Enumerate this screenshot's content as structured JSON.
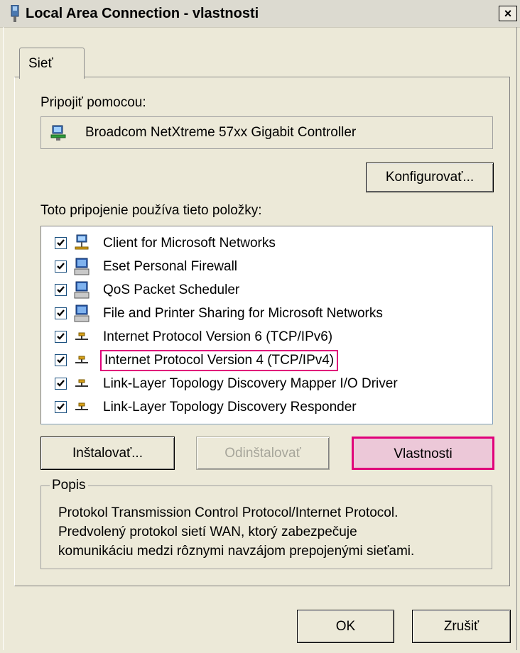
{
  "window": {
    "title": "Local Area Connection - vlastnosti",
    "close_label": "×"
  },
  "tabs": [
    {
      "label": "Sieť",
      "active": true
    }
  ],
  "connect_using": {
    "label": "Pripojiť pomocou:",
    "adapter_name": "Broadcom NetXtreme 57xx Gigabit Controller",
    "configure_label": "Konfigurovať..."
  },
  "components": {
    "label": "Toto pripojenie používa tieto položky:",
    "items": [
      {
        "label": "Client for Microsoft Networks",
        "checked": true,
        "icon": "network-client-icon"
      },
      {
        "label": "Eset Personal Firewall",
        "checked": true,
        "icon": "computer-service-icon"
      },
      {
        "label": "QoS Packet Scheduler",
        "checked": true,
        "icon": "computer-service-icon"
      },
      {
        "label": "File and Printer Sharing for Microsoft Networks",
        "checked": true,
        "icon": "computer-service-icon"
      },
      {
        "label": "Internet Protocol Version 6 (TCP/IPv6)",
        "checked": true,
        "icon": "protocol-icon"
      },
      {
        "label": "Internet Protocol Version 4 (TCP/IPv4)",
        "checked": true,
        "icon": "protocol-icon",
        "highlighted": true
      },
      {
        "label": "Link-Layer Topology Discovery Mapper I/O Driver",
        "checked": true,
        "icon": "protocol-icon"
      },
      {
        "label": "Link-Layer Topology Discovery Responder",
        "checked": true,
        "icon": "protocol-icon"
      }
    ]
  },
  "actions": {
    "install": "Inštalovať...",
    "uninstall": "Odinštalovať",
    "properties": "Vlastnosti"
  },
  "description": {
    "legend": "Popis",
    "text": "Protokol Transmission Control Protocol/Internet Protocol.\nPredvolený protokol sietí WAN, ktorý zabezpečuje\nkomunikáciu medzi rôznymi navzájom prepojenými sieťami."
  },
  "footer": {
    "ok": "OK",
    "cancel": "Zrušiť"
  },
  "colors": {
    "highlight_border": "#e0007a",
    "highlight_fill": "#ecc8d8",
    "window_bg": "#ece9d8"
  }
}
